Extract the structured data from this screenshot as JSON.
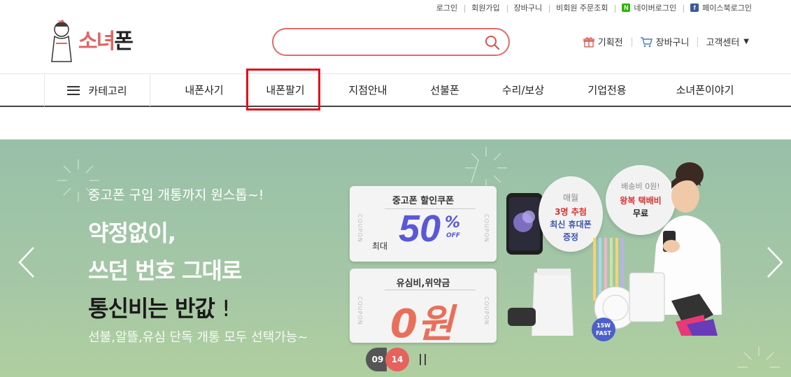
{
  "util": {
    "login": "로그인",
    "join": "회원가입",
    "cart": "장바구니",
    "guest_order": "비회원 주문조회",
    "naver_login": "네이버로그인",
    "facebook_login": "페이스북로그인",
    "naver_badge": "N",
    "facebook_badge": "f"
  },
  "logo": {
    "text_pink": "소녀",
    "text_dark": "폰"
  },
  "search": {
    "placeholder": "",
    "value": ""
  },
  "header_right": {
    "events": "기획전",
    "cart": "장바구니",
    "support": "고객센터",
    "support_caret": "▼"
  },
  "nav": {
    "category": "카테고리",
    "items": [
      "내폰사기",
      "내폰팔기",
      "지점안내",
      "선불폰",
      "수리/보상",
      "기업전용",
      "소녀폰이야기"
    ]
  },
  "banner": {
    "subtitle": "중고폰 구입 개통까지 원스톱~!",
    "headline1": "약정없이,",
    "headline2": "쓰던 번호 그대로",
    "headline3": "통신비는 반값",
    "headline3_mark": "!",
    "note": "선불,알뜰,유심 단독 개통 모두 선택가능~",
    "coupon1_title": "중고폰 할인쿠폰",
    "coupon1_max": "최대",
    "coupon1_value": "50",
    "coupon1_pct": "%",
    "coupon1_off": "OFF",
    "coupon2_title": "유심비,위약금",
    "coupon2_value": "0원",
    "coupon_side": "COUPON",
    "bubble1_l1": "매월",
    "bubble1_l2": "3명 추첨",
    "bubble1_l3": "최신 휴대폰",
    "bubble1_l4": "증정",
    "bubble2_l1": "배송비 0원!",
    "bubble2_l2": "왕복 택배비",
    "bubble2_l3": "무료",
    "charger_badge": "15W FAST"
  },
  "pager": {
    "current": "09",
    "total": "14"
  },
  "colors": {
    "accent": "#e36461",
    "highlight": "#e0111a",
    "banner_bg": "#a5c7a6"
  }
}
